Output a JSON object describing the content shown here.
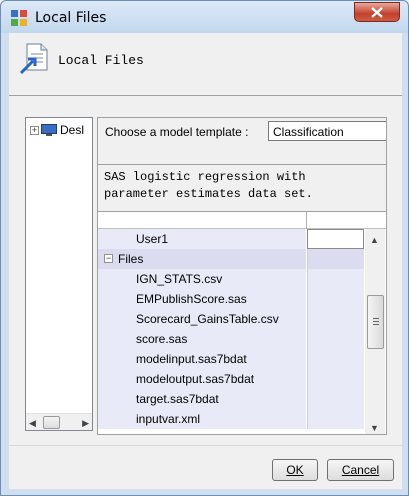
{
  "window": {
    "title": "Local Files"
  },
  "header": {
    "title": "Local Files"
  },
  "tree": {
    "root_label": "Desktop",
    "root_label_visible": "Desl",
    "expander": "+"
  },
  "template": {
    "label": "Choose a model template :",
    "selected": "Classification",
    "description": "SAS logistic regression with\nparameter estimates data set."
  },
  "grid": {
    "rows": [
      {
        "name": "User1",
        "type": "item",
        "value_editable": true
      },
      {
        "name": "Files",
        "type": "group",
        "expander": "−"
      },
      {
        "name": "IGN_STATS.csv",
        "type": "item"
      },
      {
        "name": "EMPublishScore.sas",
        "type": "item"
      },
      {
        "name": "Scorecard_GainsTable.csv",
        "type": "item"
      },
      {
        "name": "score.sas",
        "type": "item"
      },
      {
        "name": "modelinput.sas7bdat",
        "type": "item"
      },
      {
        "name": "modeloutput.sas7bdat",
        "type": "item"
      },
      {
        "name": "target.sas7bdat",
        "type": "item"
      },
      {
        "name": "inputvar.xml",
        "type": "item"
      }
    ]
  },
  "buttons": {
    "ok": "OK",
    "cancel": "Cancel"
  },
  "colors": {
    "title_bar": "#c2d7ee",
    "close_button": "#c2412a",
    "grid_row": "#e8ebf7"
  }
}
